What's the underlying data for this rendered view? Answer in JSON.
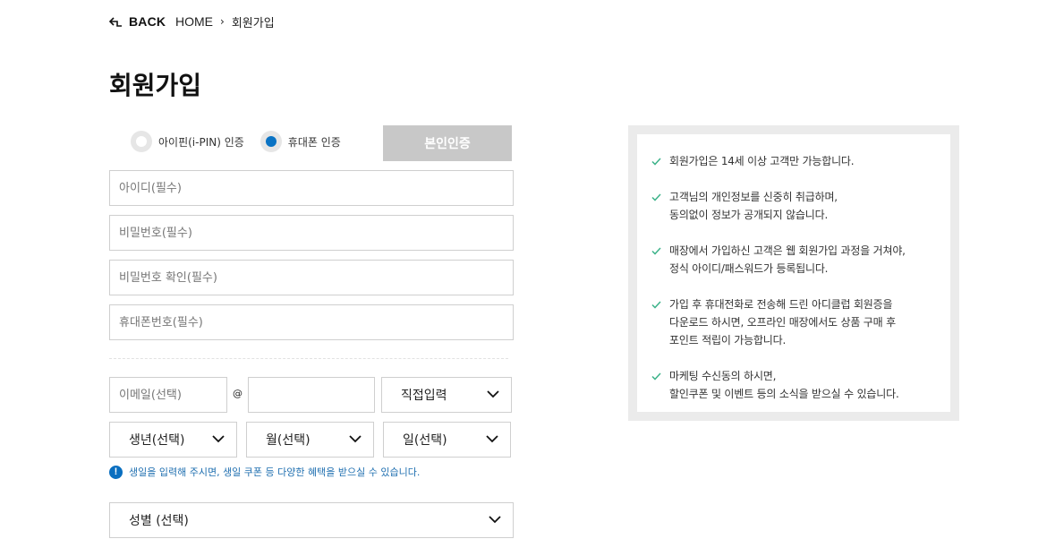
{
  "breadcrumb": {
    "back_label": "BACK",
    "home": "HOME",
    "separator": "›",
    "current": "회원가입"
  },
  "page_title": "회원가입",
  "verify": {
    "options": [
      {
        "label": "아이핀(i-PIN) 인증",
        "checked": false
      },
      {
        "label": "휴대폰 인증",
        "checked": true
      }
    ],
    "button_label": "본인인증"
  },
  "form": {
    "id_placeholder": "아이디(필수)",
    "password_placeholder": "비밀번호(필수)",
    "password_confirm_placeholder": "비밀번호 확인(필수)",
    "phone_placeholder": "휴대폰번호(필수)",
    "email_local_placeholder": "이메일(선택)",
    "email_at": "@",
    "email_domain_value": "",
    "email_domain_select": "직접입력",
    "birth_year": "생년(선택)",
    "birth_month": "월(선택)",
    "birth_day": "일(선택)",
    "birth_notice": "생일을 입력해 주시면, 생일 쿠폰 등 다양한 혜택을 받으실 수 있습니다.",
    "notice_icon": "!",
    "gender": "성별 (선택)"
  },
  "info": {
    "items": [
      "회원가입은 14세 이상 고객만 가능합니다.",
      "고객님의 개인정보를 신중히 취급하며,\n동의없이 정보가 공개되지 않습니다.",
      "매장에서 가입하신 고객은 웹 회원가입 과정을 거쳐야,\n정식 아이디/패스워드가 등록됩니다.",
      "가입 후 휴대전화로 전송해 드린 아디클럽 회원증을\n다운로드 하시면, 오프라인 매장에서도 상품 구매 후\n포인트 적립이 가능합니다.",
      "마케팅 수신동의 하시면,\n할인쿠폰 및 이벤트 등의 소식을 받으실 수 있습니다."
    ]
  },
  "colors": {
    "accent": "#0a73c4",
    "check": "#3db38a",
    "button_disabled": "#c8c8c8",
    "panel_border": "#ebebeb"
  }
}
